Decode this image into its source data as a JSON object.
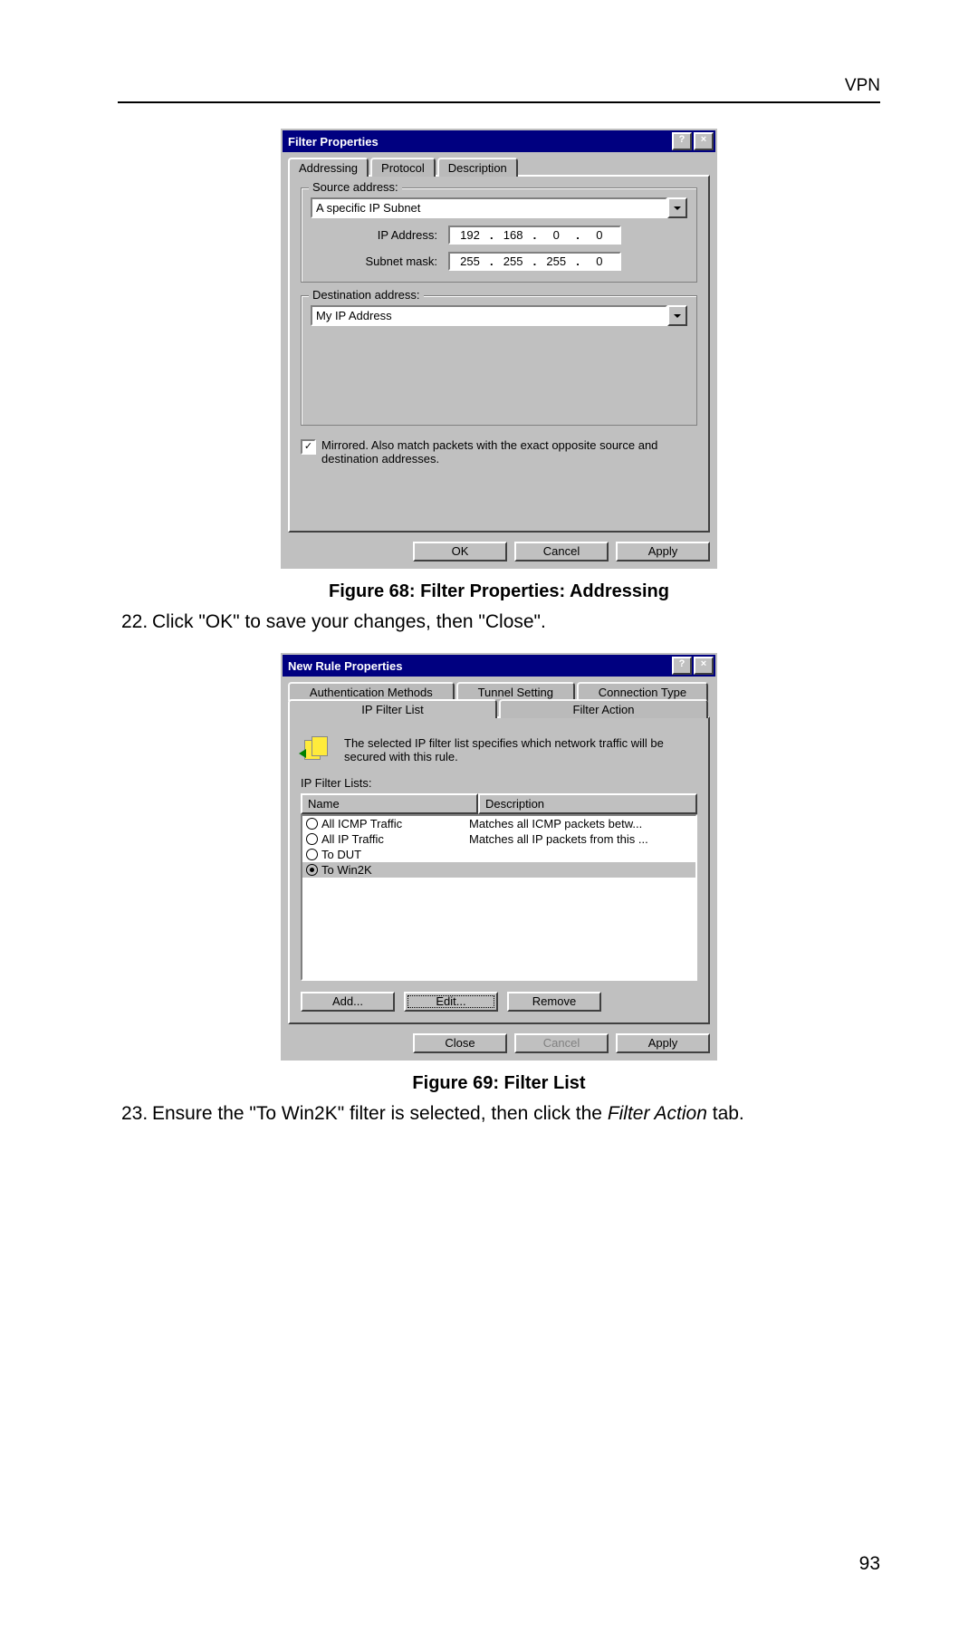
{
  "header": {
    "section": "VPN"
  },
  "pagenum": "93",
  "figure68": {
    "caption": "Figure 68: Filter Properties: Addressing",
    "window_title": "Filter Properties",
    "tabs": [
      "Addressing",
      "Protocol",
      "Description"
    ],
    "source_group": "Source address:",
    "source_dropdown": "A specific IP Subnet",
    "ip_label": "IP Address:",
    "ip_parts": [
      "192",
      "168",
      "0",
      "0"
    ],
    "mask_label": "Subnet mask:",
    "mask_parts": [
      "255",
      "255",
      "255",
      "0"
    ],
    "dest_group": "Destination address:",
    "dest_dropdown": "My IP Address",
    "mirrored": "Mirrored. Also match packets with the exact opposite source and destination addresses.",
    "buttons": {
      "ok": "OK",
      "cancel": "Cancel",
      "apply": "Apply"
    },
    "helpclose": {
      "help": "?",
      "close": "×"
    }
  },
  "step22": {
    "num": "22.",
    "text": "Click \"OK\" to save your changes, then \"Close\"."
  },
  "figure69": {
    "caption": "Figure 69: Filter List",
    "window_title": "New Rule Properties",
    "tabs_row1": [
      "Authentication Methods",
      "Tunnel Setting",
      "Connection Type"
    ],
    "tabs_row2": [
      "IP Filter List",
      "Filter Action"
    ],
    "info": "The selected IP filter list specifies which network traffic will be secured with this rule.",
    "list_label": "IP Filter Lists:",
    "cols": [
      "Name",
      "Description"
    ],
    "rows": [
      {
        "name": "All ICMP Traffic",
        "desc": "Matches all ICMP packets betw...",
        "selected": false,
        "on": false
      },
      {
        "name": "All IP Traffic",
        "desc": "Matches all IP packets from this ...",
        "selected": false,
        "on": false
      },
      {
        "name": "To DUT",
        "desc": "",
        "selected": false,
        "on": false
      },
      {
        "name": "To Win2K",
        "desc": "",
        "selected": true,
        "on": true
      }
    ],
    "buttons": {
      "add": "Add...",
      "edit": "Edit...",
      "remove": "Remove",
      "close": "Close",
      "cancel": "Cancel",
      "apply": "Apply"
    }
  },
  "step23": {
    "num": "23.",
    "pre": "Ensure the \"To Win2K\" filter is selected, then click the ",
    "italic": "Filter Action",
    "post": " tab."
  }
}
